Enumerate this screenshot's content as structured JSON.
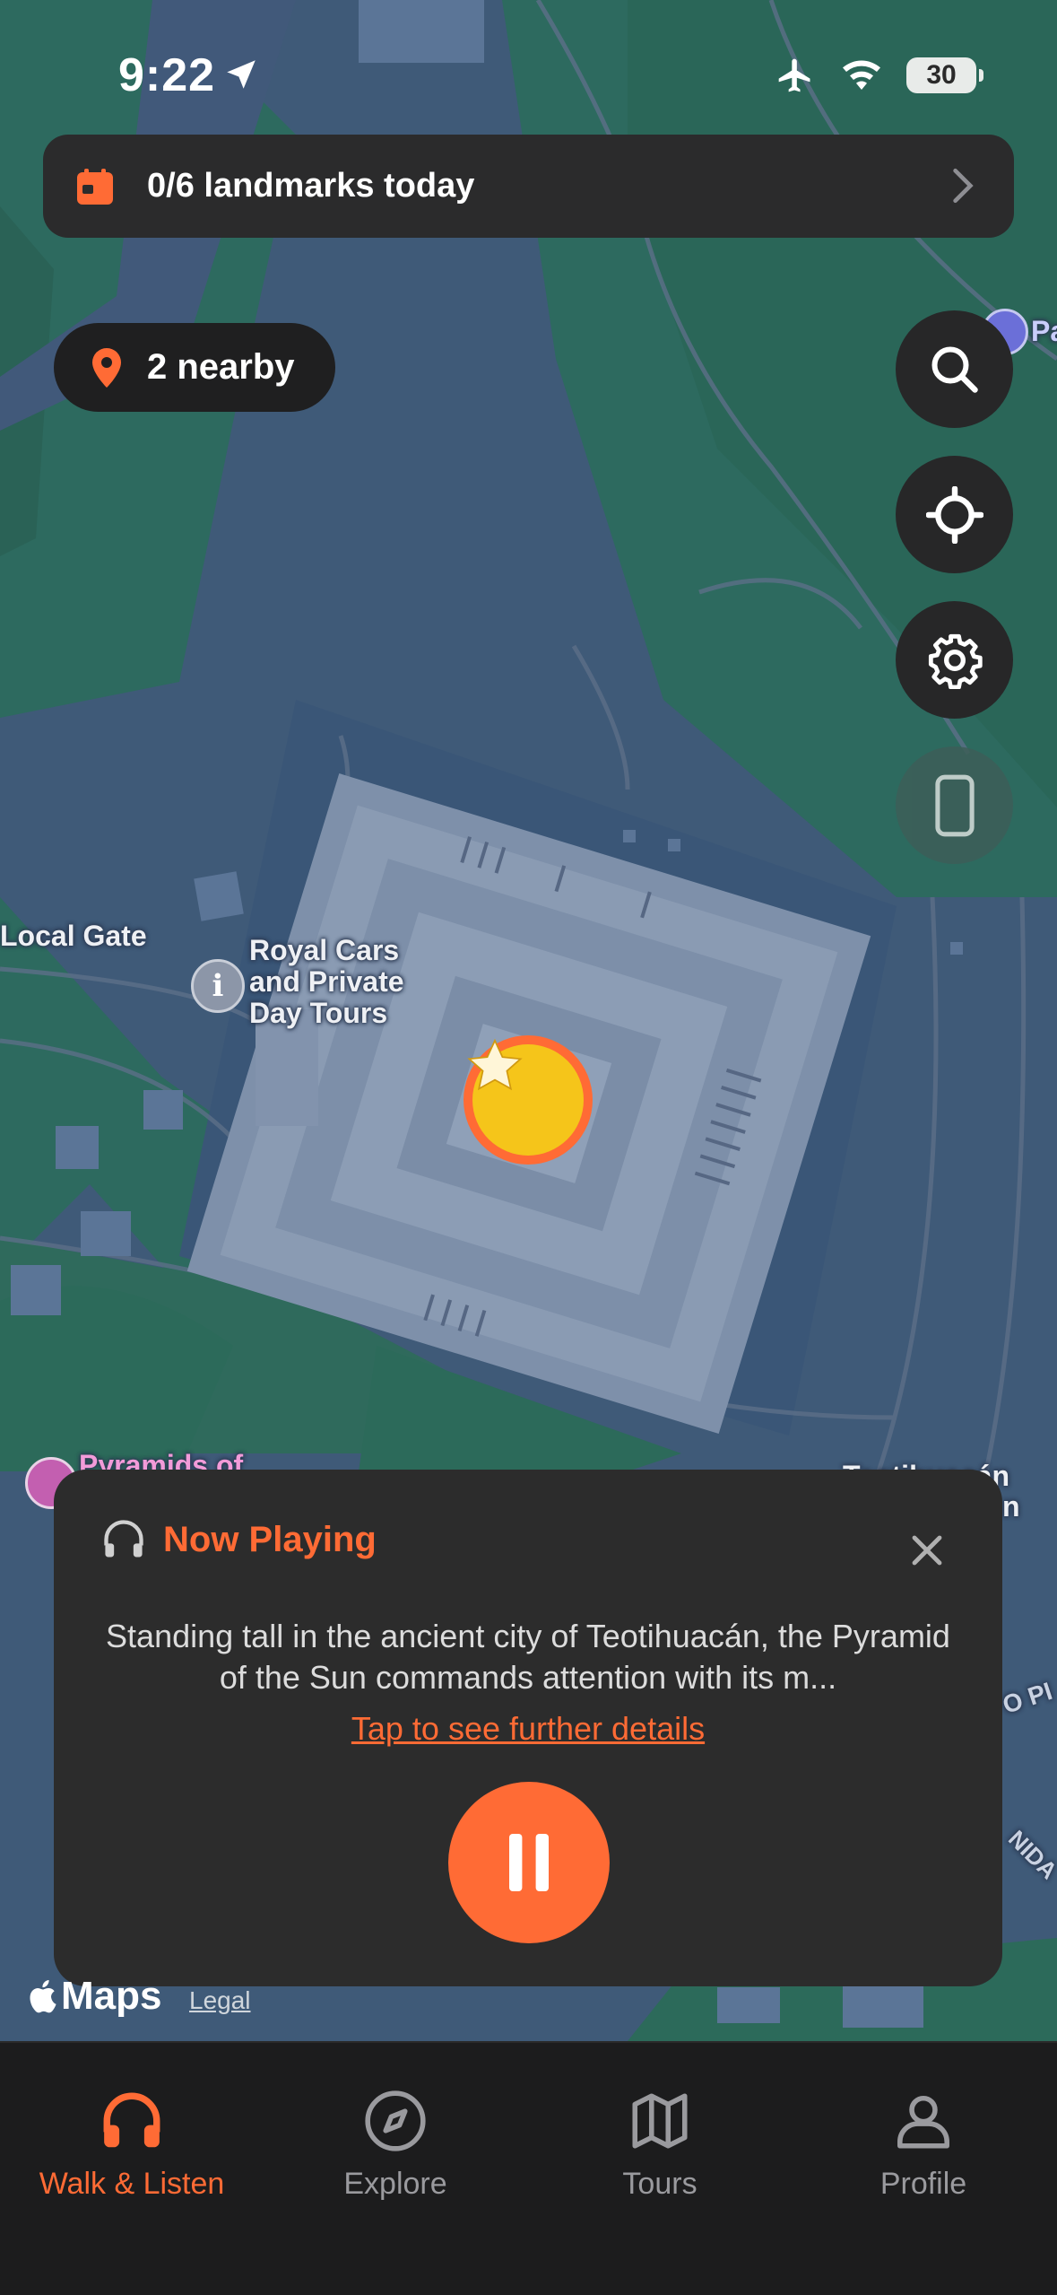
{
  "status_bar": {
    "time": "9:22",
    "battery": "30"
  },
  "banner": {
    "text": "0/6 landmarks today",
    "accent": "#ff6b35"
  },
  "nearby": {
    "label": "2 nearby"
  },
  "map": {
    "labels": {
      "local_gate": "Local Gate",
      "poi": "Royal Cars and Private Day Tours",
      "poi_lines": [
        "Royal Cars",
        "and Private",
        "Day Tours"
      ],
      "pyramids_of": "Pyramids of",
      "teotihuacan_partial": "Teotihuacán",
      "teotihuacan_partial_2": "n",
      "pa_partial": "Pa",
      "road_1": "O PI",
      "road_2": "NIDA"
    },
    "legal": "Legal",
    "maps_brand": "Maps"
  },
  "now_playing": {
    "title": "Now Playing",
    "description": "Standing tall in the ancient city of Teotihuacán, the Pyramid of the Sun commands attention with its m...",
    "link": "Tap to see further details"
  },
  "tabs": [
    {
      "label": "Walk & Listen",
      "icon": "headphones-icon",
      "active": true
    },
    {
      "label": "Explore",
      "icon": "compass-icon",
      "active": false
    },
    {
      "label": "Tours",
      "icon": "map-icon",
      "active": false
    },
    {
      "label": "Profile",
      "icon": "person-icon",
      "active": false
    }
  ],
  "colors": {
    "accent": "#ff6b35",
    "card": "#2c2c2c",
    "tabbar": "#1c1c1d",
    "marker": "#f4c21a"
  }
}
